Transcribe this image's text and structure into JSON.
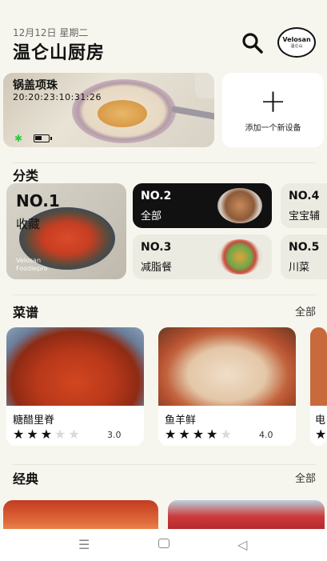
{
  "header": {
    "date": "12月12日 星期二",
    "title": "温仑山厨房",
    "avatar_brand": "Velosan",
    "avatar_sub": "温仑山"
  },
  "device": {
    "name": "锅盖项珠",
    "time": "20:20:23:10:31:26",
    "battery_level": 0.5
  },
  "add_device": {
    "label": "添加一个新设备"
  },
  "categories": {
    "title": "分类",
    "items": [
      {
        "no": "NO.1",
        "name": "收藏",
        "brand": "Velosan\nFoodiepro"
      },
      {
        "no": "NO.2",
        "name": "全部"
      },
      {
        "no": "NO.3",
        "name": "减脂餐"
      },
      {
        "no": "NO.4",
        "name": "宝宝辅"
      },
      {
        "no": "NO.5",
        "name": "川菜"
      }
    ]
  },
  "recipes": {
    "title": "菜谱",
    "more": "全部",
    "items": [
      {
        "name": "糖醋里脊",
        "rating": 3,
        "score": "3.0"
      },
      {
        "name": "鱼羊鲜",
        "rating": 4,
        "score": "4.0"
      },
      {
        "name": "电"
      }
    ]
  },
  "classic": {
    "title": "经典",
    "more": "全部"
  },
  "navbar": {
    "menu_icon": "menu-icon",
    "home_icon": "home-icon",
    "back_icon": "back-icon"
  }
}
